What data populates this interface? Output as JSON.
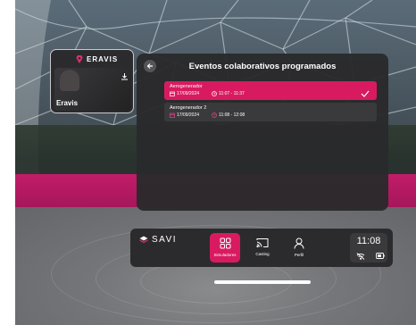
{
  "user_card": {
    "brand": "ERAVIS",
    "name": "Eravis"
  },
  "panel": {
    "title": "Eventos colaborativos programados",
    "events": [
      {
        "name": "Aerogenerador",
        "date": "17/09/2024",
        "time": "11:07 - 11:37",
        "selected": true
      },
      {
        "name": "Aerogenerador 2",
        "date": "17/09/2024",
        "time": "11:08 - 12:08",
        "selected": false
      }
    ]
  },
  "dock": {
    "logo": "SAVI",
    "nav": [
      {
        "label": "Simuladores",
        "icon": "grid-icon",
        "active": true
      },
      {
        "label": "Casting",
        "icon": "cast-icon",
        "active": false
      },
      {
        "label": "Perfil",
        "icon": "person-icon",
        "active": false
      }
    ],
    "clock": "11:08"
  },
  "colors": {
    "accent": "#d81b60",
    "panel": "#2a2a2c",
    "wall": "#c21c68"
  },
  "icons": [
    "back-arrow-icon",
    "calendar-icon",
    "clock-icon",
    "check-icon",
    "download-icon",
    "wifi-off-icon",
    "battery-icon",
    "savi-logo-icon",
    "eravis-logo-icon"
  ]
}
